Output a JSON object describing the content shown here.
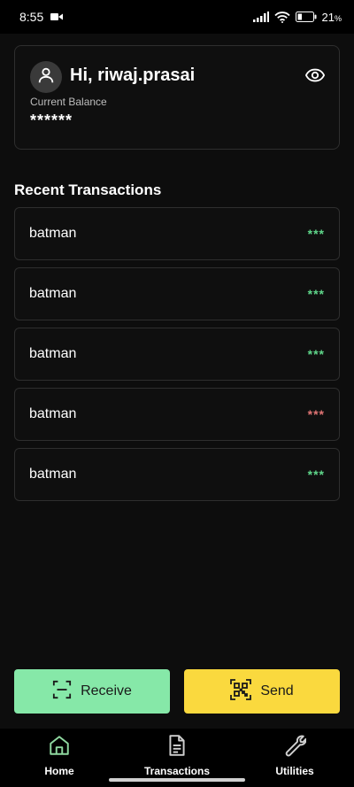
{
  "status_bar": {
    "time": "8:55",
    "battery_percent": "21",
    "battery_unit": "%"
  },
  "balance_card": {
    "greeting": "Hi, riwaj.prasai",
    "balance_label": "Current Balance",
    "balance_value": "******",
    "icons": {
      "avatar": "user-icon",
      "toggle": "eye-icon"
    }
  },
  "transactions": {
    "title": "Recent Transactions",
    "items": [
      {
        "name": "batman",
        "amount": "***",
        "type": "credit"
      },
      {
        "name": "batman",
        "amount": "***",
        "type": "credit"
      },
      {
        "name": "batman",
        "amount": "***",
        "type": "credit"
      },
      {
        "name": "batman",
        "amount": "***",
        "type": "debit"
      },
      {
        "name": "batman",
        "amount": "***",
        "type": "credit"
      }
    ]
  },
  "actions": {
    "receive_label": "Receive",
    "send_label": "Send"
  },
  "nav": {
    "home": "Home",
    "transactions": "Transactions",
    "utilities": "Utilities"
  },
  "colors": {
    "credit": "#5fd68a",
    "debit": "#e07474",
    "receive_bg": "#86e8a8",
    "send_bg": "#fad93e",
    "active_nav_icon": "#8fd9a0"
  }
}
